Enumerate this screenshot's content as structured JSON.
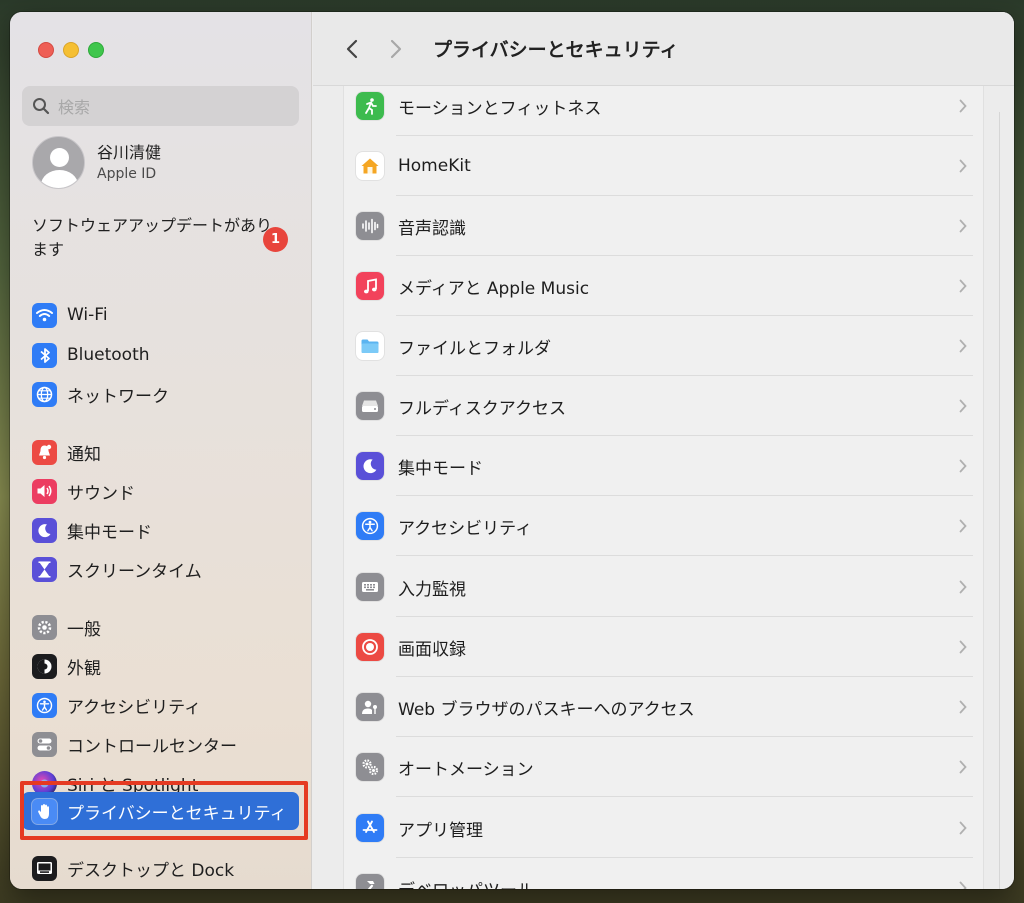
{
  "window": {
    "controls": [
      "close",
      "minimize",
      "zoom"
    ]
  },
  "sidebar": {
    "search_placeholder": "検索",
    "account": {
      "name": "谷川清健",
      "subtitle": "Apple ID"
    },
    "update": {
      "text": "ソフトウェアアップデートがあります",
      "badge": "1"
    },
    "items": [
      {
        "label": "Wi-Fi",
        "icon": "wifi-icon",
        "color": "#2f7cf6"
      },
      {
        "label": "Bluetooth",
        "icon": "bluetooth-icon",
        "color": "#2f7cf6"
      },
      {
        "label": "ネットワーク",
        "icon": "globe-icon",
        "color": "#2f7cf6"
      },
      {
        "label": "通知",
        "icon": "bell-icon",
        "color": "#ec4a43"
      },
      {
        "label": "サウンド",
        "icon": "speaker-icon",
        "color": "#ec3d61"
      },
      {
        "label": "集中モード",
        "icon": "moon-icon",
        "color": "#5a50d8"
      },
      {
        "label": "スクリーンタイム",
        "icon": "hourglass-icon",
        "color": "#5a50d8"
      },
      {
        "label": "一般",
        "icon": "gear-icon",
        "color": "#8e8e93"
      },
      {
        "label": "外観",
        "icon": "appearance-icon",
        "color": "#1c1c1e"
      },
      {
        "label": "アクセシビリティ",
        "icon": "accessibility-icon",
        "color": "#2f7cf6"
      },
      {
        "label": "コントロールセンター",
        "icon": "toggles-icon",
        "color": "#8e8e93"
      },
      {
        "label": "Siri と Spotlight",
        "icon": "siri-icon",
        "color": "#2a2a3a"
      },
      {
        "label": "プライバシーとセキュリティ",
        "icon": "hand-icon",
        "color": "#2f7cf6",
        "selected": true
      },
      {
        "label": "デスクトップと Dock",
        "icon": "dock-icon",
        "color": "#1c1c1e"
      }
    ]
  },
  "main": {
    "title": "プライバシーとセキュリティ",
    "rows": [
      {
        "label": "モーションとフィットネス",
        "icon": "fitness-icon",
        "color": "#3dbb4e"
      },
      {
        "label": "HomeKit",
        "icon": "home-icon",
        "color": "#ffffff"
      },
      {
        "label": "音声認識",
        "icon": "waveform-icon",
        "color": "#8e8e93"
      },
      {
        "label": "メディアと Apple Music",
        "icon": "music-icon",
        "color": "#f2425b"
      },
      {
        "label": "ファイルとフォルダ",
        "icon": "folder-icon",
        "color": "#ffffff"
      },
      {
        "label": "フルディスクアクセス",
        "icon": "disk-icon",
        "color": "#8e8e93"
      },
      {
        "label": "集中モード",
        "icon": "moon-icon",
        "color": "#5a50d8"
      },
      {
        "label": "アクセシビリティ",
        "icon": "accessibility-icon",
        "color": "#2f7cf6"
      },
      {
        "label": "入力監視",
        "icon": "keyboard-icon",
        "color": "#8e8e93"
      },
      {
        "label": "画面収録",
        "icon": "record-icon",
        "color": "#ec4a43"
      },
      {
        "label": "Web ブラウザのパスキーへのアクセス",
        "icon": "person-key-icon",
        "color": "#8e8e93"
      },
      {
        "label": "オートメーション",
        "icon": "gears-icon",
        "color": "#8e8e93"
      },
      {
        "label": "アプリ管理",
        "icon": "appstore-icon",
        "color": "#2f7cf6"
      },
      {
        "label": "デベロッパツール",
        "icon": "hammer-icon",
        "color": "#8e8e93"
      }
    ]
  }
}
